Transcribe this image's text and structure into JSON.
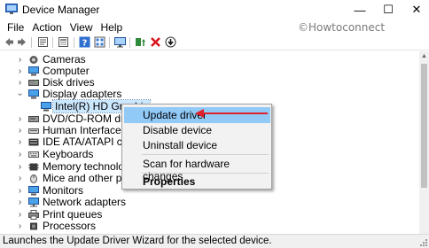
{
  "window": {
    "title": "Device Manager",
    "min_glyph": "—",
    "max_glyph": "☐",
    "close_glyph": "✕"
  },
  "menubar": {
    "items": [
      "File",
      "Action",
      "View",
      "Help"
    ]
  },
  "watermark": "©Howtoconnect",
  "toolbar": {
    "icons": [
      "back-icon",
      "forward-icon",
      "properties-icon",
      "list-icon",
      "help-icon",
      "grid-icon",
      "monitor-icon",
      "update-driver-icon",
      "uninstall-icon",
      "enable-device-icon"
    ]
  },
  "tree": {
    "items": [
      {
        "label": "Cameras",
        "expanded": false
      },
      {
        "label": "Computer",
        "expanded": false
      },
      {
        "label": "Disk drives",
        "expanded": false
      },
      {
        "label": "Display adapters",
        "expanded": true
      },
      {
        "label": "Intel(R) HD Graphic",
        "child": true,
        "selected": true
      },
      {
        "label": "DVD/CD-ROM drives",
        "expanded": false
      },
      {
        "label": "Human Interface Dev",
        "expanded": false
      },
      {
        "label": "IDE ATA/ATAPI control",
        "expanded": false
      },
      {
        "label": "Keyboards",
        "expanded": false
      },
      {
        "label": "Memory technology d",
        "expanded": false
      },
      {
        "label": "Mice and other pointin",
        "expanded": false
      },
      {
        "label": "Monitors",
        "expanded": false
      },
      {
        "label": "Network adapters",
        "expanded": false
      },
      {
        "label": "Print queues",
        "expanded": false
      },
      {
        "label": "Processors",
        "expanded": false
      }
    ]
  },
  "context_menu": {
    "items": [
      {
        "label": "Update driver",
        "highlighted": true
      },
      {
        "label": "Disable device"
      },
      {
        "label": "Uninstall device"
      },
      {
        "label": "Scan for hardware changes"
      },
      {
        "label": "Properties",
        "bold": true
      }
    ]
  },
  "statusbar": {
    "text": "Launches the Update Driver Wizard for the selected device."
  },
  "colors": {
    "highlight": "#91c9f7",
    "arrow": "#e0202a",
    "selection": "#cce8ff"
  }
}
